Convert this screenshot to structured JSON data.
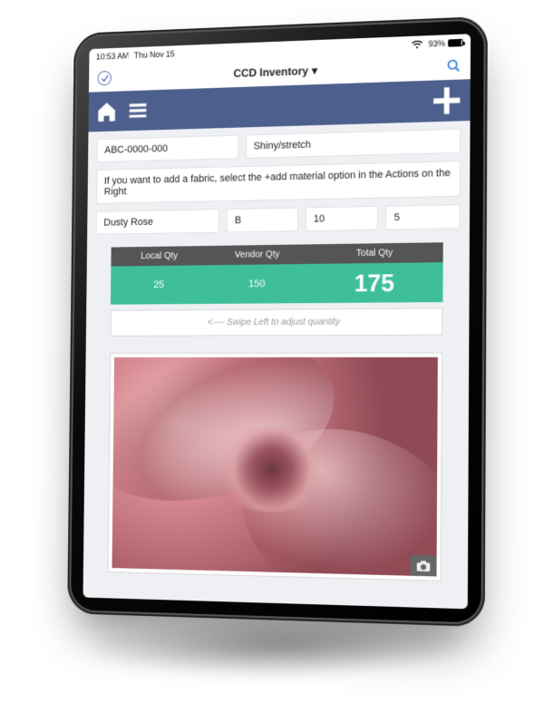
{
  "status": {
    "time": "10:53 AM",
    "date": "Thu Nov 15",
    "battery_pct": "93%"
  },
  "title": {
    "label": "CCD Inventory",
    "dropdown_glyph": "▾"
  },
  "nav": {
    "home_icon": "home-icon",
    "menu_icon": "menu-icon",
    "add_icon": "plus-icon"
  },
  "record": {
    "sku": "ABC-0000-000",
    "name": "Shiny/stretch",
    "help": "If you want to add a fabric, select the +add material option in the Actions on the Right",
    "color": "Dusty Rose",
    "grade": "B",
    "size1": "10",
    "size2": "5"
  },
  "qty": {
    "labels": {
      "local": "Local Qty",
      "vendor": "Vendor Qty",
      "total": "Total Qty"
    },
    "local": "25",
    "vendor": "150",
    "total": "175",
    "swipe_hint": "<----  Swipe Left to adjust quantity"
  },
  "colors": {
    "navbar": "#4d5f8c",
    "accent": "#3fbf99"
  }
}
